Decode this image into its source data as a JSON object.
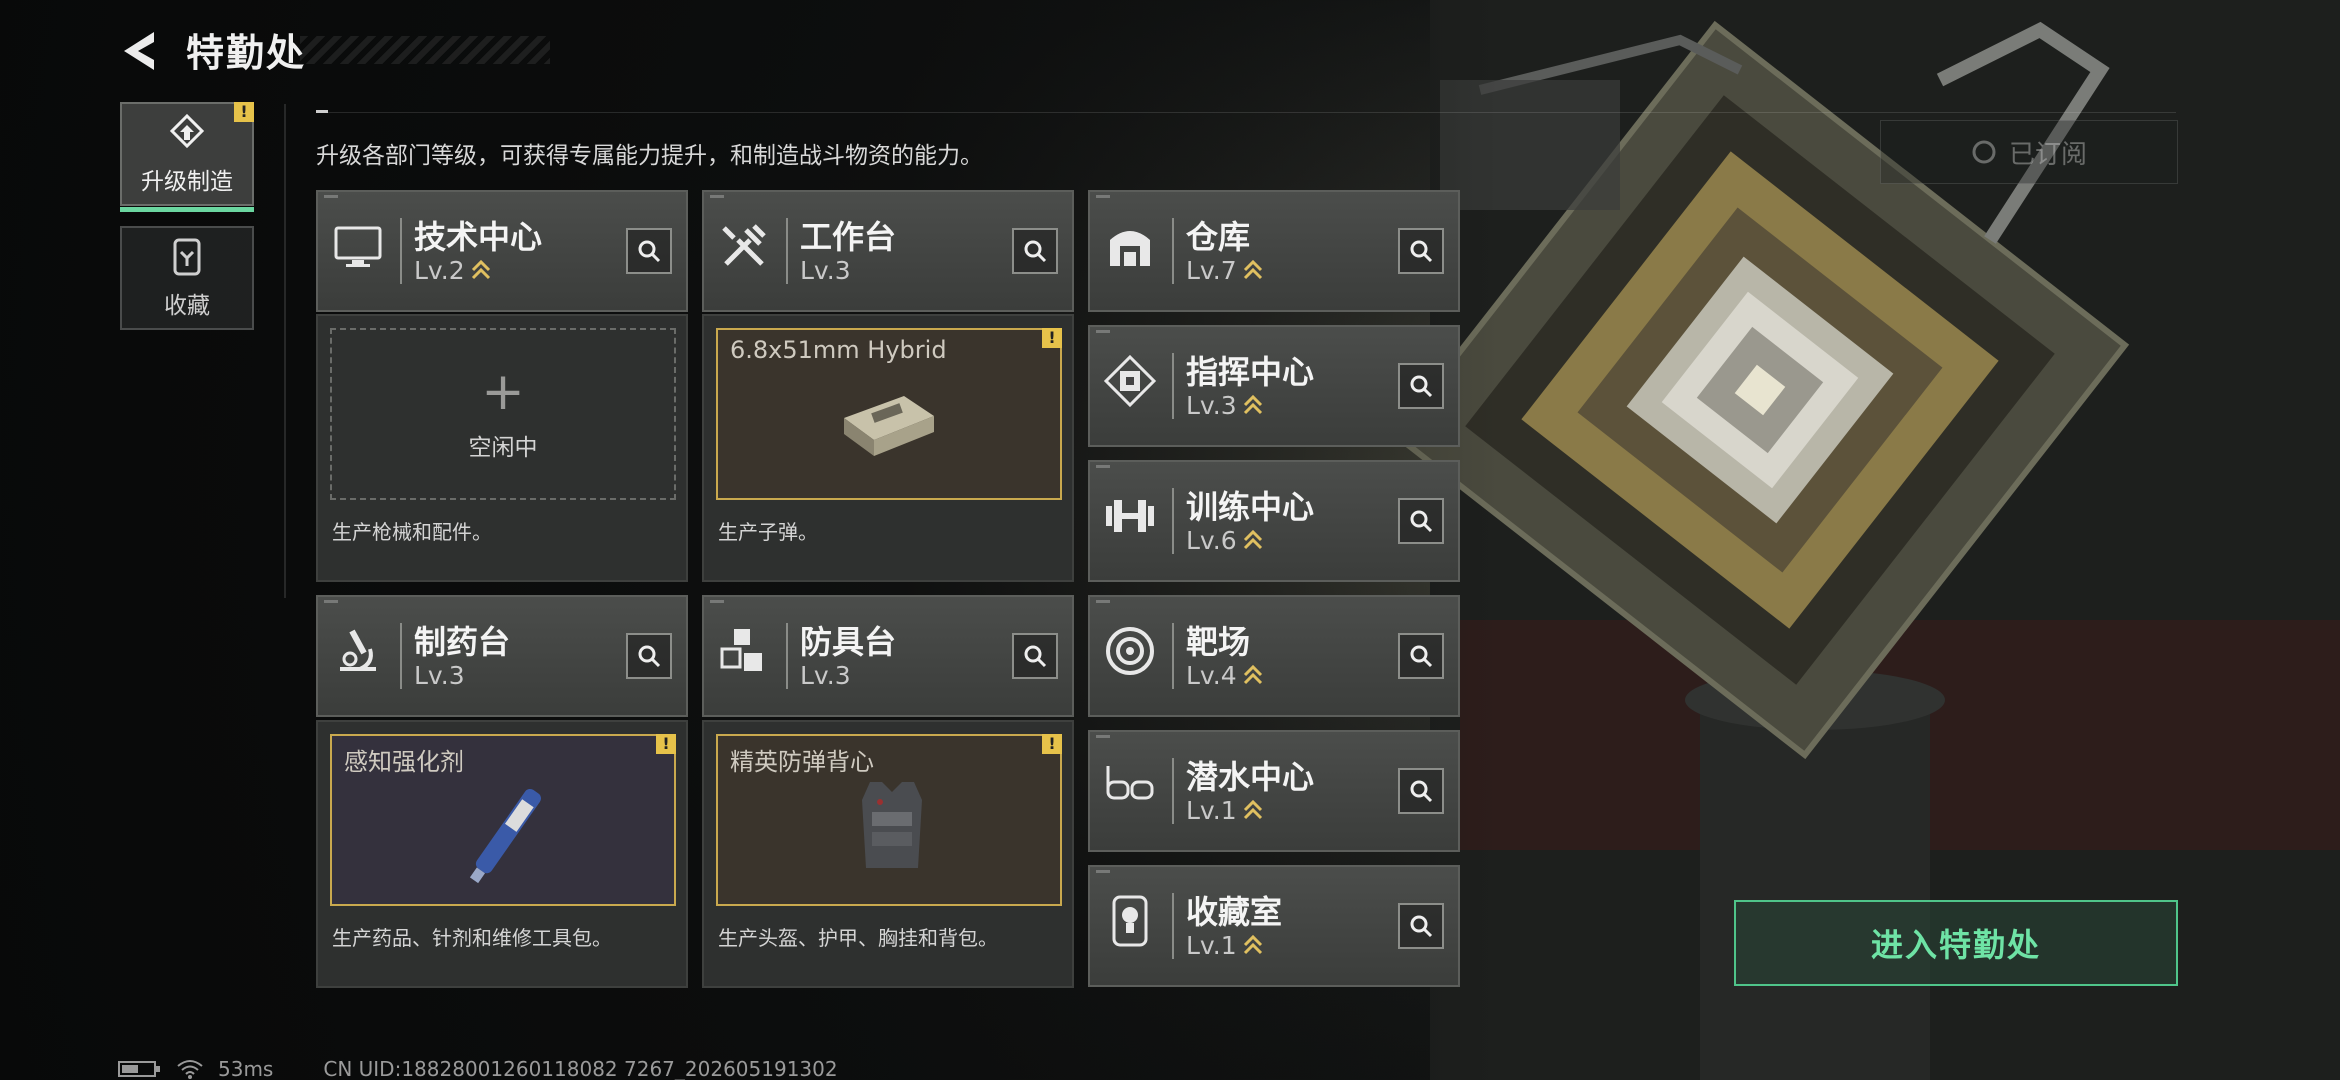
{
  "header": {
    "title": "特勤处"
  },
  "sidebar": {
    "tabs": [
      {
        "label": "升级制造",
        "active": true,
        "alert": "!"
      },
      {
        "label": "收藏",
        "active": false
      }
    ]
  },
  "description": "升级各部门等级，可获得专属能力提升，和制造战斗物资的能力。",
  "subscribe_label": "已订阅",
  "facilities": [
    {
      "name": "技术中心",
      "level": "Lv.2",
      "icon": "monitor-icon",
      "upgradable": true
    },
    {
      "name": "工作台",
      "level": "Lv.3",
      "icon": "tools-icon",
      "upgradable": false
    },
    {
      "name": "仓库",
      "level": "Lv.7",
      "icon": "warehouse-icon",
      "upgradable": true
    },
    {
      "name": "指挥中心",
      "level": "Lv.3",
      "icon": "chip-icon",
      "upgradable": true
    },
    {
      "name": "训练中心",
      "level": "Lv.6",
      "icon": "dumbbell-icon",
      "upgradable": true
    },
    {
      "name": "制药台",
      "level": "Lv.3",
      "icon": "microscope-icon",
      "upgradable": false
    },
    {
      "name": "防具台",
      "level": "Lv.3",
      "icon": "cubes-icon",
      "upgradable": false
    },
    {
      "name": "靶场",
      "level": "Lv.4",
      "icon": "target-icon",
      "upgradable": true
    },
    {
      "name": "潜水中心",
      "level": "Lv.1",
      "icon": "goggles-icon",
      "upgradable": true
    },
    {
      "name": "收藏室",
      "level": "Lv.1",
      "icon": "trophy-icon",
      "upgradable": true
    }
  ],
  "production": [
    {
      "state": "idle",
      "idle_text": "空闲中",
      "plus": "+",
      "desc": "生产枪械和配件。"
    },
    {
      "state": "item",
      "item_name": "6.8x51mm Hybrid",
      "alert": "!",
      "desc": "生产子弹。",
      "tint": "#3a342c"
    },
    {
      "state": "item",
      "item_name": "感知强化剂",
      "alert": "!",
      "desc": "生产药品、针剂和维修工具包。",
      "tint": "#34313d"
    },
    {
      "state": "item",
      "item_name": "精英防弹背心",
      "alert": "!",
      "desc": "生产头盔、护甲、胸挂和背包。",
      "tint": "#3a342c"
    }
  ],
  "enter_button": "进入特勤处",
  "status": {
    "ping": "53ms",
    "uid": "CN UID:18828001260118082 7267_202605191302"
  },
  "colors": {
    "accent_green": "#6ee3a5",
    "alert_yellow": "#e6c24a",
    "upgrade_gold": "#e0c060"
  }
}
